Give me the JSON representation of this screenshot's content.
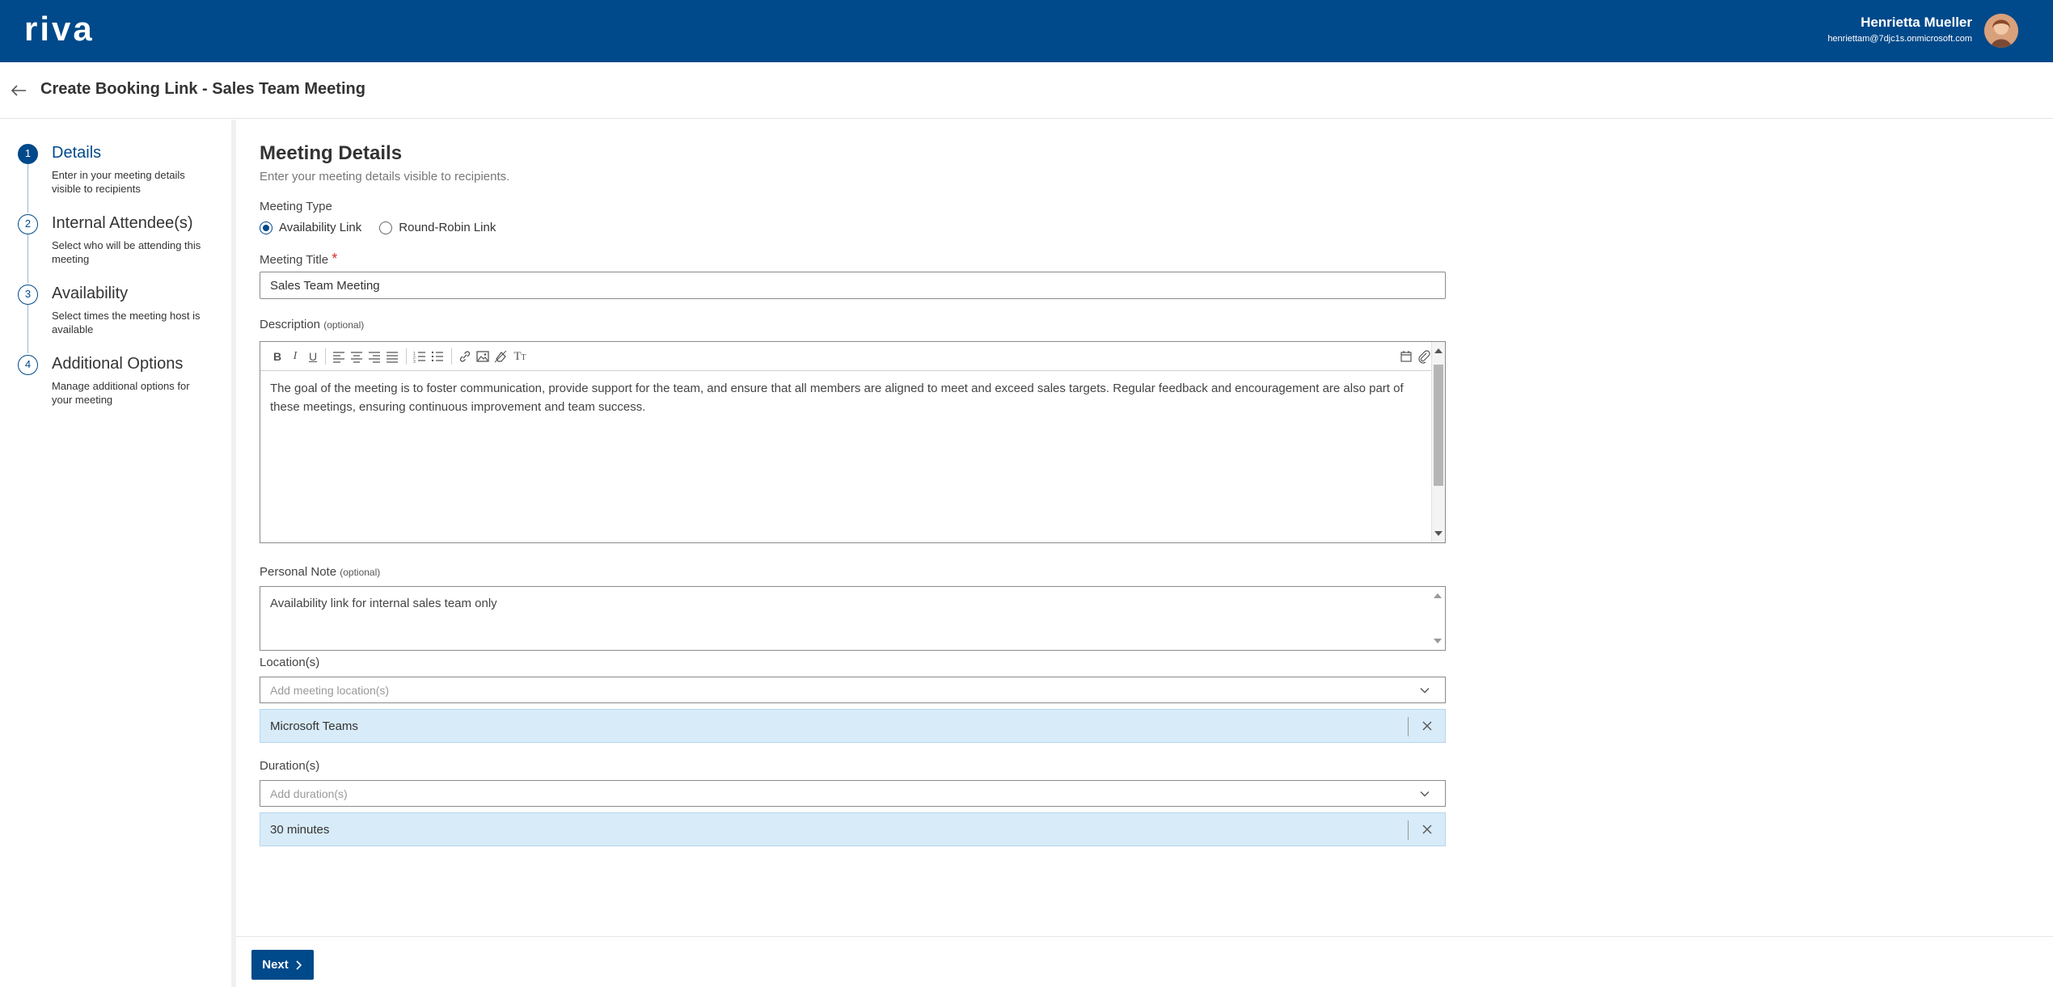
{
  "brand": {
    "logo_text": "riva",
    "primary_color": "#00498a"
  },
  "user": {
    "name": "Henrietta Mueller",
    "email": "henriettam@7djc1s.onmicrosoft.com"
  },
  "header": {
    "title": "Create Booking Link - Sales Team Meeting"
  },
  "steps": [
    {
      "number": "1",
      "title": "Details",
      "desc": "Enter in your meeting details visible to recipients",
      "active": true
    },
    {
      "number": "2",
      "title": "Internal Attendee(s)",
      "desc": "Select who will be attending this meeting",
      "active": false
    },
    {
      "number": "3",
      "title": "Availability",
      "desc": "Select times the meeting host is available",
      "active": false
    },
    {
      "number": "4",
      "title": "Additional Options",
      "desc": "Manage additional options for your meeting",
      "active": false
    }
  ],
  "form": {
    "section_title": "Meeting Details",
    "section_sub": "Enter your meeting details visible to recipients.",
    "meeting_type_label": "Meeting Type",
    "meeting_types": [
      {
        "label": "Availability Link",
        "checked": true
      },
      {
        "label": "Round-Robin Link",
        "checked": false
      }
    ],
    "title_label": "Meeting Title",
    "required_mark": "*",
    "title_value": "Sales Team Meeting",
    "description_label": "Description",
    "optional_text": "(optional)",
    "description_value": "The goal of the meeting is to foster communication, provide support for the team, and ensure that all members are aligned to meet and exceed sales targets. Regular feedback and encouragement are also part of these meetings, ensuring continuous improvement and team success.",
    "note_label": "Personal Note",
    "note_value": "Availability link for internal sales team only",
    "location_label": "Location(s)",
    "location_placeholder": "Add meeting location(s)",
    "location_selected": "Microsoft Teams",
    "duration_label": "Duration(s)",
    "duration_placeholder": "Add duration(s)",
    "duration_selected": "30 minutes"
  },
  "toolbar_icons": [
    "bold-icon",
    "italic-icon",
    "underline-icon",
    "align-left-icon",
    "align-center-icon",
    "align-right-icon",
    "align-justify-icon",
    "ordered-list-icon",
    "bullet-list-icon",
    "link-icon",
    "image-icon",
    "clear-format-icon",
    "text-size-icon",
    "calendar-icon",
    "attachment-icon"
  ],
  "footer": {
    "next_label": "Next"
  }
}
